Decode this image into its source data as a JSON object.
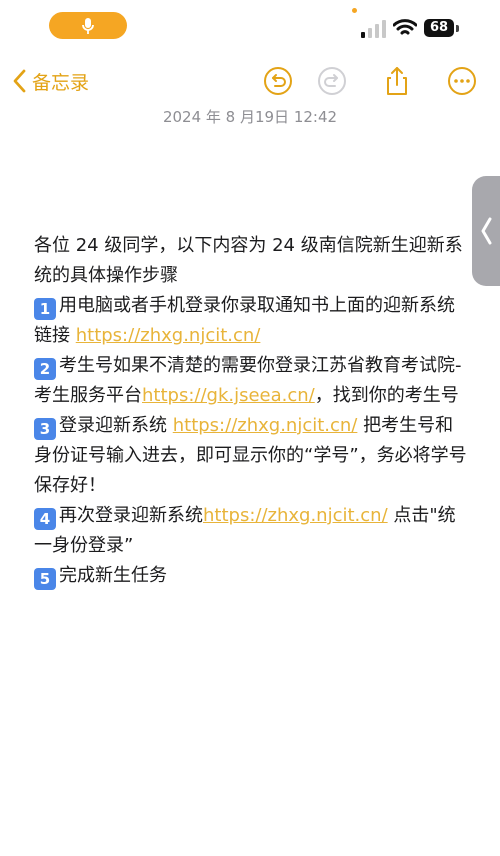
{
  "status_bar": {
    "battery": "68"
  },
  "nav": {
    "back_label": "备忘录"
  },
  "note": {
    "timestamp": "2024 年 8 月19日 12:42",
    "intro": "各位 24 级同学，以下内容为 24 级南信院新生迎新系统的具体操作步骤",
    "steps": [
      {
        "badge": "1",
        "text_before": "用电脑或者手机登录你录取通知书上面的迎新系统链接 ",
        "link": "https://zhxg.njcit.cn/",
        "text_after": ""
      },
      {
        "badge": "2",
        "text_before": "考生号如果不清楚的需要你登录江苏省教育考试院-考生服务平台",
        "link": "https://gk.jseea.cn/",
        "text_after": "，找到你的考生号"
      },
      {
        "badge": "3",
        "text_before": "登录迎新系统 ",
        "link": "https://zhxg.njcit.cn/",
        "text_after": " 把考生号和身份证号输入进去，即可显示你的“学号”，务必将学号保存好！"
      },
      {
        "badge": "4",
        "text_before": "再次登录迎新系统",
        "link": "https://zhxg.njcit.cn/",
        "text_after": "  点击\"统一身份登录”"
      },
      {
        "badge": "5",
        "text_before": "完成新生任务",
        "link": "",
        "text_after": ""
      }
    ]
  },
  "icons": {
    "mic": "mic-icon",
    "undo": "undo-icon",
    "redo": "redo-icon",
    "share": "share-icon",
    "more": "more-icon",
    "back": "chevron-left-icon",
    "handle": "chevron-left-icon"
  },
  "colors": {
    "accent": "#e3a316",
    "link": "#e8b43a",
    "badge": "#4a86e8",
    "mic_pill": "#f5a623"
  }
}
